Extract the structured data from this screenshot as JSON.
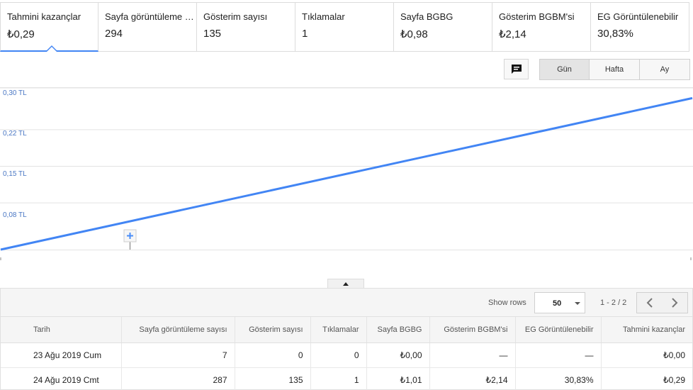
{
  "metrics": [
    {
      "label": "Tahmini kazançlar",
      "value": "₺0,29",
      "active": true
    },
    {
      "label": "Sayfa görüntüleme sayısı",
      "value": "294"
    },
    {
      "label": "Gösterim sayısı",
      "value": "135"
    },
    {
      "label": "Tıklamalar",
      "value": "1"
    },
    {
      "label": "Sayfa BGBG",
      "value": "₺0,98"
    },
    {
      "label": "Gösterim BGBM'si",
      "value": "₺2,14"
    },
    {
      "label": "EG Görüntülenebilir",
      "value": "30,83%"
    }
  ],
  "toolbar": {
    "annotation_icon": "comment-icon",
    "granularity": [
      "Gün",
      "Hafta",
      "Ay"
    ],
    "selected": "Gün"
  },
  "chart_data": {
    "type": "line",
    "x": [
      "23 Ağu 2019",
      "24 Ağu 2019"
    ],
    "series": [
      {
        "values": [
          0.0,
          0.29
        ]
      }
    ],
    "yticks": [
      "0,30 TL",
      "0,22 TL",
      "0,15 TL",
      "0,08 TL"
    ],
    "ylim": [
      0,
      0.3
    ],
    "grid": true,
    "color": "#4285f4"
  },
  "table": {
    "show_rows_label": "Show rows",
    "rows_per_page": "50",
    "range": "1 - 2 / 2",
    "headers": [
      "Tarih",
      "Sayfa görüntüleme sayısı",
      "Gösterim sayısı",
      "Tıklamalar",
      "Sayfa BGBG",
      "Gösterim BGBM'si",
      "EG Görüntülenebilir",
      "Tahmini kazançlar"
    ],
    "rows": [
      [
        "23 Ağu 2019 Cum",
        "7",
        "0",
        "0",
        "₺0,00",
        "—",
        "—",
        "₺0,00"
      ],
      [
        "24 Ağu 2019 Cmt",
        "287",
        "135",
        "1",
        "₺1,01",
        "₺2,14",
        "30,83%",
        "₺0,29"
      ]
    ]
  }
}
